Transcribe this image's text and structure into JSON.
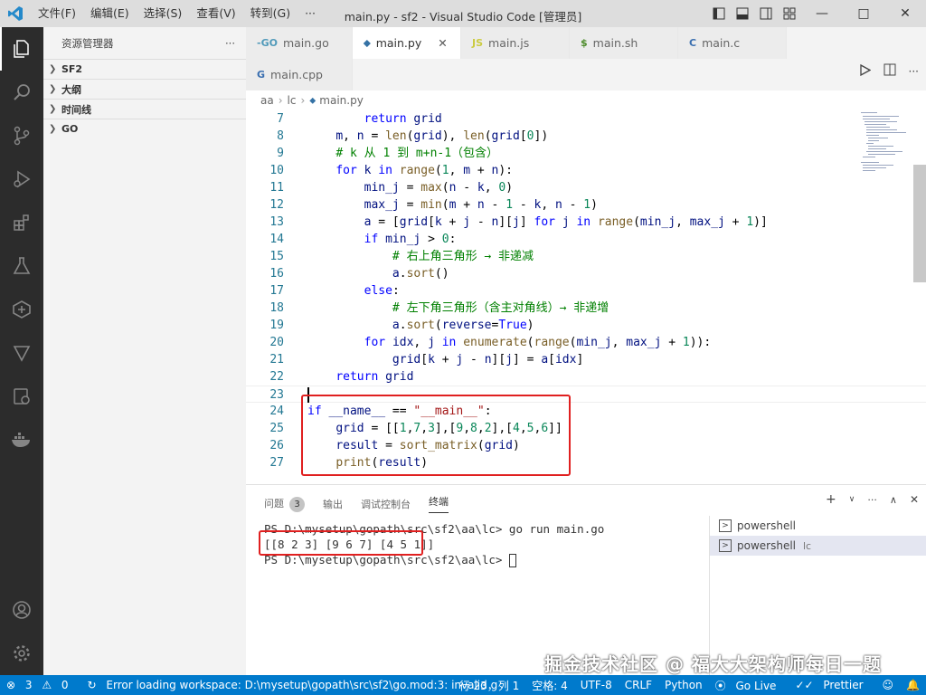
{
  "titlebar": {
    "menu": [
      "文件(F)",
      "编辑(E)",
      "选择(S)",
      "查看(V)",
      "转到(G)",
      "···"
    ],
    "title": "main.py - sf2 - Visual Studio Code [管理员]"
  },
  "sidebar": {
    "title": "资源管理器",
    "more": "···",
    "sections": [
      "SF2",
      "大纲",
      "时间线",
      "GO"
    ]
  },
  "tabs": [
    {
      "icon": "-GO",
      "label": "main.go"
    },
    {
      "icon": "⬥",
      "label": "main.py"
    },
    {
      "icon": "JS",
      "label": "main.js"
    },
    {
      "icon": "$",
      "label": "main.sh"
    },
    {
      "icon": "C",
      "label": "main.c"
    },
    {
      "icon": "G",
      "label": "main.cpp"
    }
  ],
  "breadcrumb": [
    "aa",
    "lc",
    "main.py"
  ],
  "code_lines": [
    {
      "n": "7",
      "html": "        <span class='kw'>return</span> <span class='var'>grid</span>"
    },
    {
      "n": "8",
      "html": "    <span class='var'>m</span>, <span class='var'>n</span> = <span class='fn'>len</span>(<span class='var'>grid</span>), <span class='fn'>len</span>(<span class='var'>grid</span>[<span class='nm'>0</span>])"
    },
    {
      "n": "9",
      "html": "    <span class='cm'># k 从 1 到 m+n-1（包含）</span>"
    },
    {
      "n": "10",
      "html": "    <span class='kw'>for</span> <span class='var'>k</span> <span class='kw'>in</span> <span class='fn'>range</span>(<span class='nm'>1</span>, <span class='var'>m</span> + <span class='var'>n</span>):"
    },
    {
      "n": "11",
      "html": "        <span class='var'>min_j</span> = <span class='fn'>max</span>(<span class='var'>n</span> - <span class='var'>k</span>, <span class='nm'>0</span>)"
    },
    {
      "n": "12",
      "html": "        <span class='var'>max_j</span> = <span class='fn'>min</span>(<span class='var'>m</span> + <span class='var'>n</span> - <span class='nm'>1</span> - <span class='var'>k</span>, <span class='var'>n</span> - <span class='nm'>1</span>)"
    },
    {
      "n": "13",
      "html": "        <span class='var'>a</span> = [<span class='var'>grid</span>[<span class='var'>k</span> + <span class='var'>j</span> - <span class='var'>n</span>][<span class='var'>j</span>] <span class='kw'>for</span> <span class='var'>j</span> <span class='kw'>in</span> <span class='fn'>range</span>(<span class='var'>min_j</span>, <span class='var'>max_j</span> + <span class='nm'>1</span>)]"
    },
    {
      "n": "14",
      "html": "        <span class='kw'>if</span> <span class='var'>min_j</span> &gt; <span class='nm'>0</span>:"
    },
    {
      "n": "15",
      "html": "            <span class='cm'># 右上角三角形 → 非递减</span>"
    },
    {
      "n": "16",
      "html": "            <span class='var'>a</span>.<span class='fn'>sort</span>()"
    },
    {
      "n": "17",
      "html": "        <span class='kw'>else</span>:"
    },
    {
      "n": "18",
      "html": "            <span class='cm'># 左下角三角形（含主对角线）→ 非递增</span>"
    },
    {
      "n": "19",
      "html": "            <span class='var'>a</span>.<span class='fn'>sort</span>(<span class='var'>reverse</span>=<span class='kw'>True</span>)"
    },
    {
      "n": "20",
      "html": "        <span class='kw'>for</span> <span class='var'>idx</span>, <span class='var'>j</span> <span class='kw'>in</span> <span class='fn'>enumerate</span>(<span class='fn'>range</span>(<span class='var'>min_j</span>, <span class='var'>max_j</span> + <span class='nm'>1</span>)):"
    },
    {
      "n": "21",
      "html": "            <span class='var'>grid</span>[<span class='var'>k</span> + <span class='var'>j</span> - <span class='var'>n</span>][<span class='var'>j</span>] = <span class='var'>a</span>[<span class='var'>idx</span>]"
    },
    {
      "n": "22",
      "html": "    <span class='kw'>return</span> <span class='var'>grid</span>"
    },
    {
      "n": "23",
      "html": ""
    },
    {
      "n": "24",
      "html": "<span class='kw'>if</span> <span class='var'>__name__</span> == <span class='st'>\"__main__\"</span>:"
    },
    {
      "n": "25",
      "html": "    <span class='var'>grid</span> = [[<span class='nm'>1</span>,<span class='nm'>7</span>,<span class='nm'>3</span>],[<span class='nm'>9</span>,<span class='nm'>8</span>,<span class='nm'>2</span>],[<span class='nm'>4</span>,<span class='nm'>5</span>,<span class='nm'>6</span>]]"
    },
    {
      "n": "26",
      "html": "    <span class='var'>result</span> = <span class='fn'>sort_matrix</span>(<span class='var'>grid</span>)"
    },
    {
      "n": "27",
      "html": "    <span class='fn'>print</span>(<span class='var'>result</span>)"
    }
  ],
  "panel": {
    "tabs": [
      "问题",
      "输出",
      "调试控制台",
      "终端"
    ],
    "problems_count": "3",
    "terminal": [
      "PS D:\\mysetup\\gopath\\src\\sf2\\aa\\lc> go run main.go",
      "[[8 2 3] [9 6 7] [4 5 1]]",
      "PS D:\\mysetup\\gopath\\src\\sf2\\aa\\lc> "
    ],
    "terminals": [
      {
        "label": "powershell",
        "suffix": ""
      },
      {
        "label": "powershell",
        "suffix": "lc"
      }
    ]
  },
  "statusbar": {
    "errors": "3",
    "warnings": "0",
    "message": "Error loading workspace: D:\\mysetup\\gopath\\src\\sf2\\go.mod:3: invalid g",
    "position": "行 23，列 1",
    "spaces": "空格: 4",
    "encoding": "UTF-8",
    "eol": "CRLF",
    "language": "Python",
    "golive": "Go Live",
    "prettier": "Prettier"
  },
  "watermark": "掘金技术社区 @ 福大大架构师每日一题",
  "colors": {
    "accent": "#007acc",
    "highlight": "#e02020"
  }
}
